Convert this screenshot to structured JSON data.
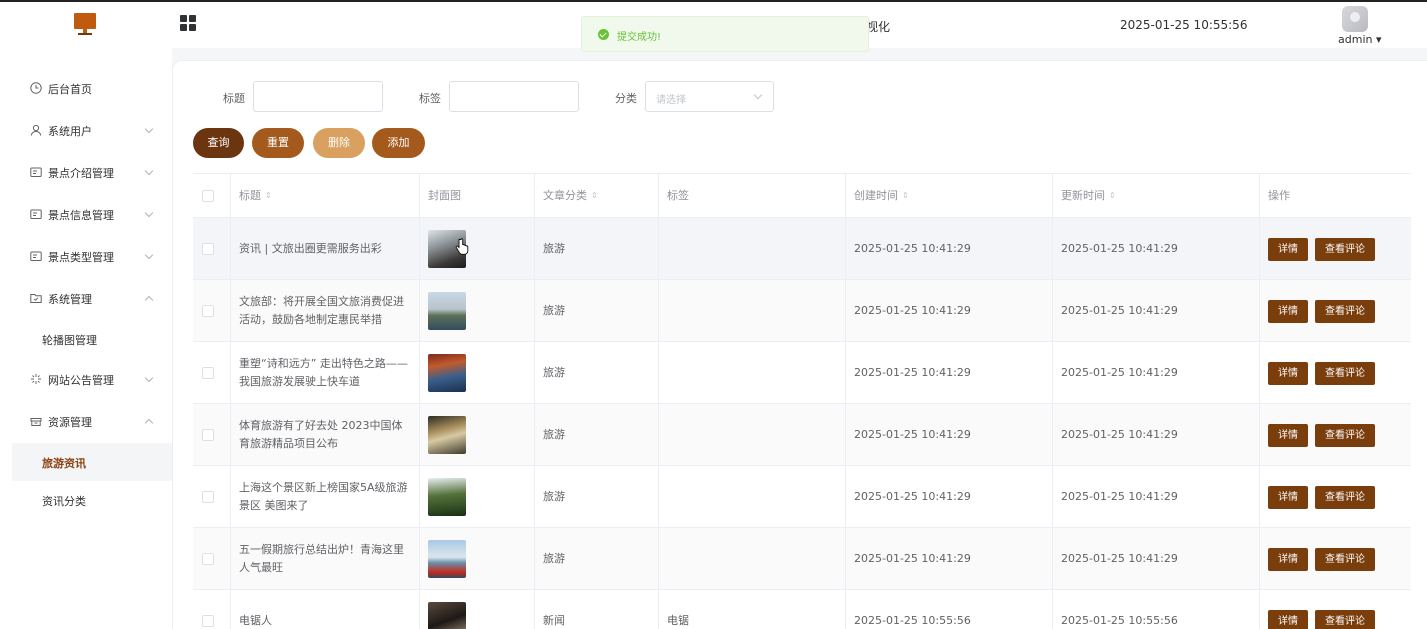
{
  "header": {
    "title_tail": "视化",
    "datetime": "2025-01-25 10:55:56",
    "user": "admin ▾"
  },
  "toast": {
    "message": "提交成功!"
  },
  "sidebar": {
    "items": [
      {
        "label": "后台首页",
        "icon": "clock-icon"
      },
      {
        "label": "系统用户",
        "icon": "user-icon"
      },
      {
        "label": "景点介绍管理",
        "icon": "card-icon"
      },
      {
        "label": "景点信息管理",
        "icon": "card-icon"
      },
      {
        "label": "景点类型管理",
        "icon": "card-icon"
      },
      {
        "label": "系统管理",
        "icon": "folder-icon"
      },
      {
        "label": "轮播图管理"
      },
      {
        "label": "网站公告管理",
        "icon": "sparkle-icon"
      },
      {
        "label": "资源管理",
        "icon": "box-icon"
      },
      {
        "label": "旅游资讯"
      },
      {
        "label": "资讯分类"
      }
    ]
  },
  "filters": {
    "title_label": "标题",
    "tag_label": "标签",
    "category_label": "分类",
    "category_placeholder": "请选择",
    "title_value": "",
    "tag_value": ""
  },
  "actions": {
    "search": "查询",
    "reset": "重置",
    "delete": "删除",
    "add": "添加"
  },
  "table": {
    "headers": {
      "title": "标题",
      "cover": "封面图",
      "category": "文章分类",
      "tag": "标签",
      "created": "创建时间",
      "updated": "更新时间",
      "ops": "操作"
    },
    "detail_label": "详情",
    "comments_label": "查看评论",
    "rows": [
      {
        "title": "资讯 | 文旅出圈更需服务出彩",
        "category": "旅游",
        "tag": "",
        "created": "2025-01-25 10:41:29",
        "updated": "2025-01-25 10:41:29"
      },
      {
        "title": "文旅部：将开展全国文旅消费促进活动，鼓励各地制定惠民举措",
        "category": "旅游",
        "tag": "",
        "created": "2025-01-25 10:41:29",
        "updated": "2025-01-25 10:41:29"
      },
      {
        "title": "重塑“诗和远方” 走出特色之路——我国旅游发展驶上快车道",
        "category": "旅游",
        "tag": "",
        "created": "2025-01-25 10:41:29",
        "updated": "2025-01-25 10:41:29"
      },
      {
        "title": "体育旅游有了好去处 2023中国体育旅游精品项目公布",
        "category": "旅游",
        "tag": "",
        "created": "2025-01-25 10:41:29",
        "updated": "2025-01-25 10:41:29"
      },
      {
        "title": "上海这个景区新上榜国家5A级旅游景区 美图来了",
        "category": "旅游",
        "tag": "",
        "created": "2025-01-25 10:41:29",
        "updated": "2025-01-25 10:41:29"
      },
      {
        "title": "五一假期旅行总结出炉！青海这里人气最旺",
        "category": "旅游",
        "tag": "",
        "created": "2025-01-25 10:41:29",
        "updated": "2025-01-25 10:41:29"
      },
      {
        "title": "电锯人",
        "category": "新闻",
        "tag": "电锯",
        "created": "2025-01-25 10:55:56",
        "updated": "2025-01-25 10:55:56"
      }
    ]
  },
  "colors": {
    "brand_dark": "#6b3510",
    "brand": "#a45a1c",
    "brand_light": "#d9a060",
    "success": "#67c23a"
  }
}
